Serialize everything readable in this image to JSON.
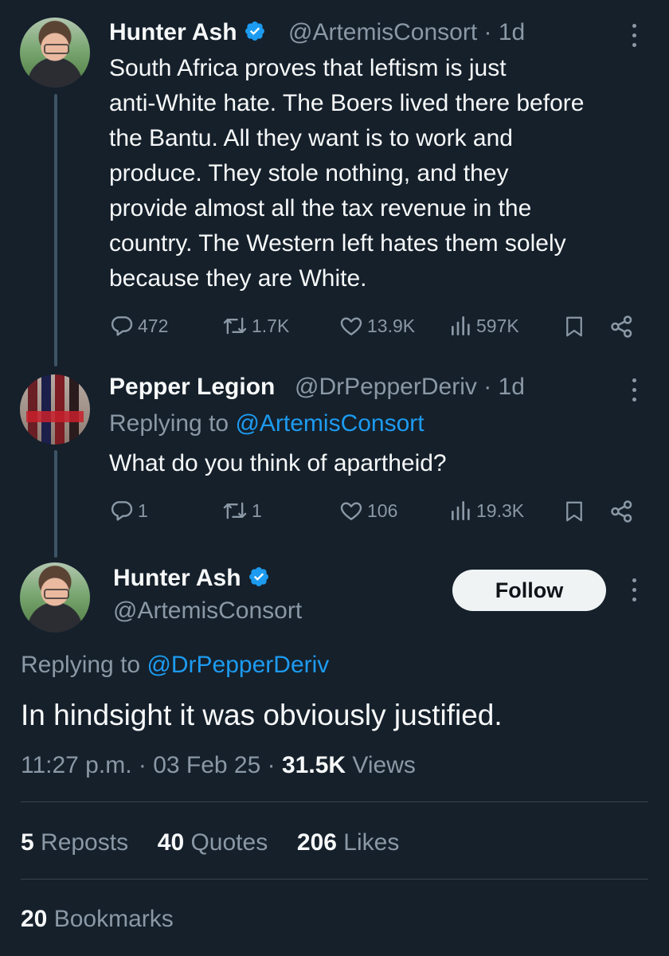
{
  "tweet1": {
    "name": "Hunter Ash",
    "handle": "@ArtemisConsort",
    "sep": " · ",
    "time": "1d",
    "lines": [
      "South Africa proves that leftism is just",
      "anti-White hate. The Boers lived there before",
      "the Bantu. All they want is to work and",
      "produce. They stole nothing, and they",
      "provide almost all the tax revenue in the",
      "country. The Western left hates them solely",
      "because they are White."
    ],
    "replies": "472",
    "reposts": "1.7K",
    "likes": "13.9K",
    "views": "597K"
  },
  "tweet2": {
    "name": "Pepper Legion",
    "handle": "@DrPepperDeriv",
    "sep": " · ",
    "time": "1d",
    "replying_prefix": "Replying to ",
    "replying_to": "@ArtemisConsort",
    "text": "What do you think of apartheid?",
    "replies": "1",
    "reposts": "1",
    "likes": "106",
    "views": "19.3K"
  },
  "main": {
    "name": "Hunter Ash",
    "handle": "@ArtemisConsort",
    "follow_label": "Follow",
    "replying_prefix": "Replying to ",
    "replying_to": "@DrPepperDeriv",
    "text": "In hindsight it was obviously justified.",
    "time": "11:27 p.m.",
    "date": "03 Feb 25",
    "sep": " · ",
    "views_count": "31.5K",
    "views_label": " Views",
    "reposts_count": "5",
    "reposts_label": " Reposts",
    "quotes_count": "40",
    "quotes_label": " Quotes",
    "likes_count": "206",
    "likes_label": " Likes",
    "bookmarks_count": "20",
    "bookmarks_label": " Bookmarks"
  },
  "icons": {
    "reply": "reply-icon",
    "repost": "repost-icon",
    "like": "heart-icon",
    "views": "views-icon",
    "bookmark": "bookmark-icon",
    "share": "share-icon",
    "verified": "verified-badge-icon",
    "more": "more-icon"
  },
  "colors": {
    "background": "#15202b",
    "text": "#f7f9f9",
    "muted": "#8b98a5",
    "link": "#1d9bf0",
    "divider": "#38444d",
    "follow_bg": "#eff3f4"
  }
}
